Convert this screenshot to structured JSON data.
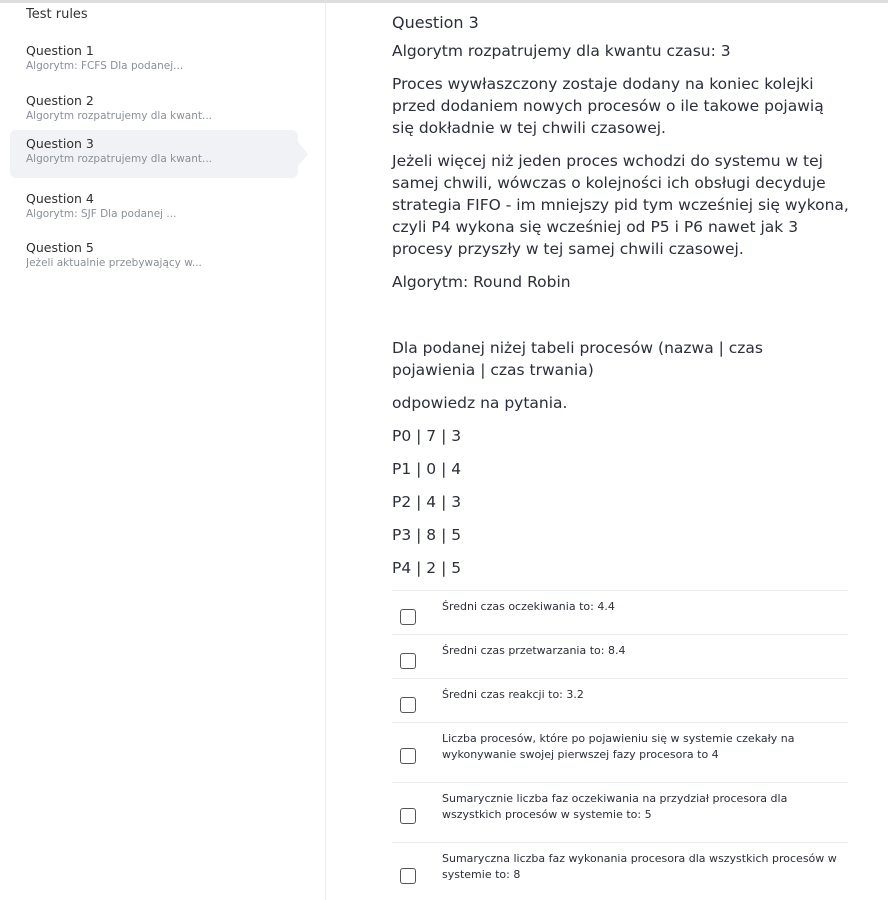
{
  "sidebar": {
    "rules_label": "Test rules",
    "items": [
      {
        "title": "Question 1",
        "subtitle": "Algorytm: FCFS Dla podanej..."
      },
      {
        "title": "Question 2",
        "subtitle": "Algorytm rozpatrujemy dla kwant..."
      },
      {
        "title": "Question 3",
        "subtitle": "Algorytm rozpatrujemy dla kwant...",
        "active": true
      },
      {
        "title": "Question 4",
        "subtitle": "Algorytm: SJF Dla podanej ..."
      },
      {
        "title": "Question 5",
        "subtitle": "Jeżeli aktualnie przebywający w..."
      }
    ]
  },
  "question": {
    "title": "Question 3",
    "paragraphs": [
      "Algorytm rozpatrujemy dla kwantu czasu: 3",
      "Proces wywłaszczony zostaje dodany na koniec kolejki przed dodaniem nowych procesów o ile takowe pojawią się dokładnie w tej chwili czasowej.",
      "Jeżeli więcej niż jeden proces wchodzi do systemu w tej samej chwili, wówczas o kolejności ich obsługi decyduje strategia FIFO - im mniejszy pid tym wcześniej się wykona, czyli P4 wykona się wcześniej od P5 i P6 nawet jak 3 procesy przyszły w tej samej chwili czasowej.",
      "Algorytm: Round Robin"
    ],
    "paragraphs_after": [
      "Dla podanej niżej tabeli procesów (nazwa | czas pojawienia | czas trwania)",
      "odpowiedz na pytania.",
      "P0 |  7 |  3",
      "P1 |  0 |  4",
      "P2 |  4 |  3",
      "P3 |  8 |  5",
      "P4 |  2 |  5"
    ]
  },
  "answers": [
    "Średni czas oczekiwania to: 4.4",
    "Średni czas przetwarzania to: 8.4",
    "Średni czas reakcji to: 3.2",
    "Liczba procesów, które po pojawieniu się w systemie czekały na wykonywanie swojej pierwszej fazy procesora to 4",
    "Sumarycznie liczba faz oczekiwania na przydział procesora dla wszystkich procesów w systemie to: 5",
    "Sumaryczna liczba faz wykonania procesora dla wszystkich procesów w systemie to: 8"
  ]
}
